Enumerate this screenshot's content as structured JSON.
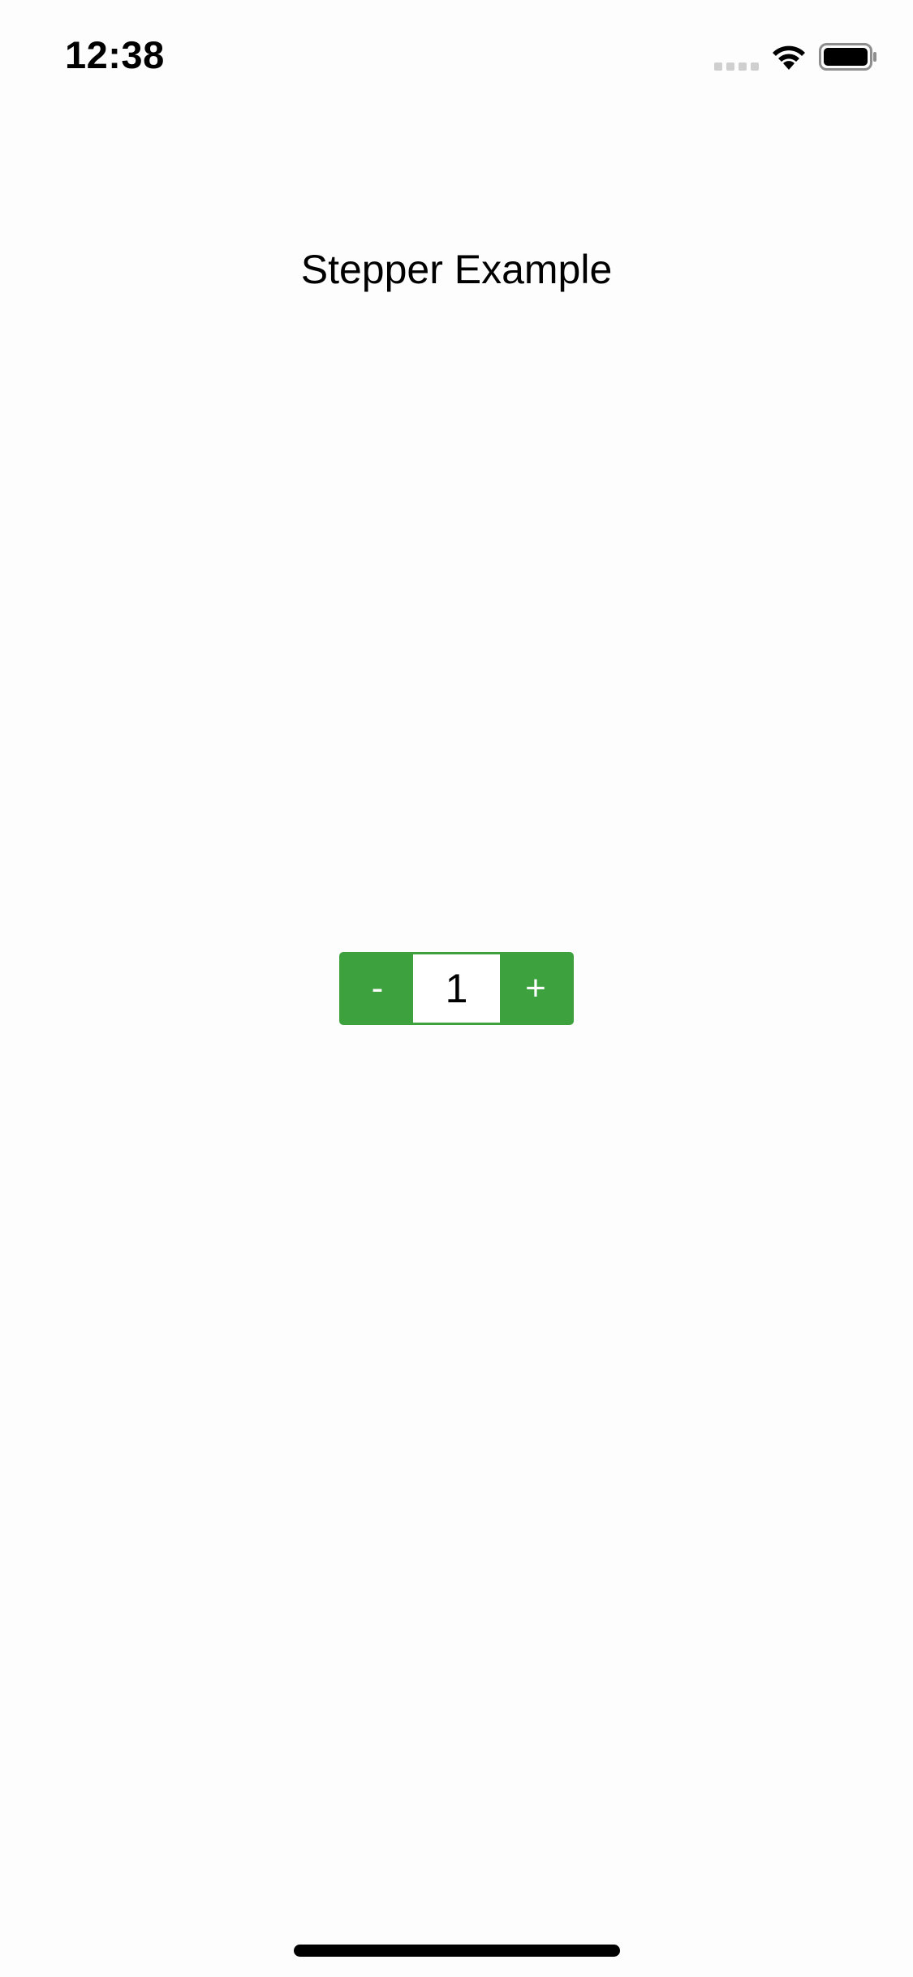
{
  "status_bar": {
    "time": "12:38",
    "signal_icon": "cellular-signal-icon",
    "wifi_icon": "wifi-icon",
    "battery_icon": "battery-icon"
  },
  "page": {
    "title": "Stepper Example"
  },
  "stepper": {
    "decrement_label": "-",
    "value": "1",
    "increment_label": "+",
    "accent_color": "#3da13d"
  }
}
